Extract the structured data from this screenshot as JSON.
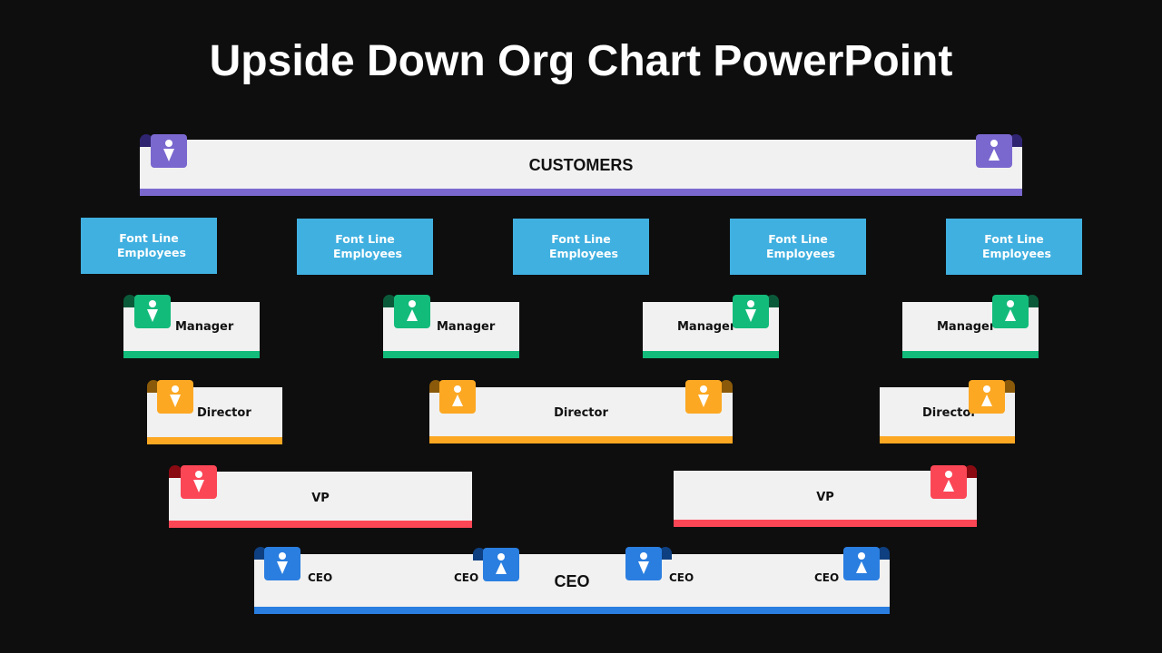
{
  "title": "Upside Down Org Chart PowerPoint",
  "colors": {
    "background": "#0e0e0e",
    "card": "#f1f1f1",
    "customers": "#7b68cf",
    "customers_dark": "#2f2470",
    "frontline": "#40b0e0",
    "manager": "#13bb7b",
    "manager_dark": "#0a5a3a",
    "director": "#fca823",
    "director_dark": "#8a5a0a",
    "vp": "#fb4656",
    "vp_dark": "#8a0a12",
    "ceo": "#2a7ee0",
    "ceo_dark": "#0e3f80"
  },
  "customers": {
    "label": "CUSTOMERS",
    "icons": [
      "male-icon",
      "female-icon"
    ]
  },
  "frontline": [
    {
      "label": "Font Line Employees"
    },
    {
      "label": "Font Line Employees"
    },
    {
      "label": "Font Line Employees"
    },
    {
      "label": "Font Line Employees"
    },
    {
      "label": "Font Line Employees"
    }
  ],
  "managers": [
    {
      "label": "Manager",
      "icon": "male-icon"
    },
    {
      "label": "Manager",
      "icon": "female-icon"
    },
    {
      "label": "Manager",
      "icon": "male-icon"
    },
    {
      "label": "Manager",
      "icon": "female-icon"
    }
  ],
  "directors": [
    {
      "label": "Director",
      "icons": [
        "male-icon"
      ]
    },
    {
      "label": "Director",
      "icons": [
        "female-icon",
        "male-icon"
      ]
    },
    {
      "label": "Director",
      "icons": [
        "female-icon"
      ]
    }
  ],
  "vps": [
    {
      "label": "VP",
      "icon": "male-icon"
    },
    {
      "label": "VP",
      "icon": "female-icon"
    }
  ],
  "ceo": {
    "label": "CEO",
    "sub_labels": [
      "CEO",
      "CEO",
      "CEO",
      "CEO"
    ],
    "icons": [
      "male-icon",
      "female-icon",
      "male-icon",
      "female-icon"
    ]
  }
}
